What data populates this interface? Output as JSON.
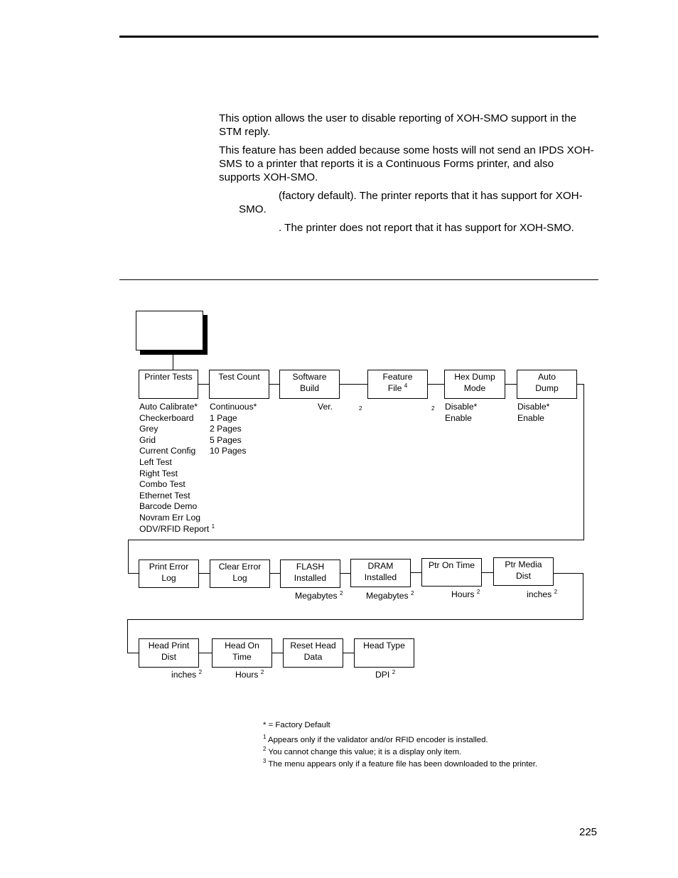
{
  "page": {
    "page_number": "225",
    "paragraphs": [
      "This option allows the user to disable reporting of XOH-SMO support in the STM reply.",
      "This feature has been added because some hosts will not send an IPDS XOH-SMS to a printer that reports it is a Continuous Forms printer, and also supports XOH-SMO."
    ],
    "options": [
      {
        "line1": "(factory default). The printer reports that it has support for XOH-",
        "line2": "SMO."
      },
      {
        "line1": ". The printer does not report that it has support for XOH-SMO."
      }
    ]
  },
  "diagram": {
    "root_label": "",
    "row1": [
      {
        "label": "Printer Tests",
        "values": [
          "Auto Calibrate*",
          "Checkerboard",
          "Grey",
          "Grid",
          "Current Config",
          "Left Test",
          "Right Test",
          "Combo Test",
          "Ethernet Test",
          "Barcode Demo",
          "Novram Err Log",
          "ODV/RFID Report"
        ],
        "last_value_sup": "1"
      },
      {
        "label": "Test Count",
        "values": [
          "Continuous*",
          "1 Page",
          "2 Pages",
          "5 Pages",
          "10 Pages"
        ]
      },
      {
        "label_line1": "Software",
        "label_line2": "Build",
        "note": "Ver.",
        "note_sup": "2"
      },
      {
        "label_line1": "Feature",
        "label_line2": "File",
        "label_sup": "4",
        "note_sup": "2"
      },
      {
        "label_line1": "Hex Dump",
        "label_line2": "Mode",
        "values": [
          "Disable*",
          "Enable"
        ]
      },
      {
        "label_line1": "Auto",
        "label_line2": "Dump",
        "values": [
          "Disable*",
          "Enable"
        ]
      }
    ],
    "row2": [
      {
        "label_line1": "Print Error",
        "label_line2": "Log"
      },
      {
        "label_line1": "Clear Error",
        "label_line2": "Log"
      },
      {
        "label_line1": "FLASH",
        "label_line2": "Installed",
        "note": "Megabytes",
        "note_sup": "2"
      },
      {
        "label_line1": "DRAM",
        "label_line2": "Installed",
        "note": "Megabytes",
        "note_sup": "2"
      },
      {
        "label_line1": "Ptr On Time",
        "label_line2": "",
        "note": "Hours",
        "note_sup": "2"
      },
      {
        "label_line1": "Ptr Media",
        "label_line2": "Dist",
        "note": "inches",
        "note_sup": "2"
      }
    ],
    "row3": [
      {
        "label_line1": "Head Print",
        "label_line2": "Dist",
        "note": "inches",
        "note_sup": "2"
      },
      {
        "label_line1": "Head On",
        "label_line2": "Time",
        "note": "Hours",
        "note_sup": "2"
      },
      {
        "label_line1": "Reset Head",
        "label_line2": "Data"
      },
      {
        "label_line1": "Head Type",
        "label_line2": "",
        "note": "DPI",
        "note_sup": "2"
      }
    ],
    "footnotes": [
      {
        "mark": "",
        "text": "* = Factory Default"
      },
      {
        "mark": "1",
        "text": "Appears only if the validator and/or RFID encoder is installed."
      },
      {
        "mark": "2",
        "text": "You cannot change this value; it is a display only item."
      },
      {
        "mark": "3",
        "text": "The menu appears only if a feature file has been downloaded to the printer."
      }
    ]
  }
}
